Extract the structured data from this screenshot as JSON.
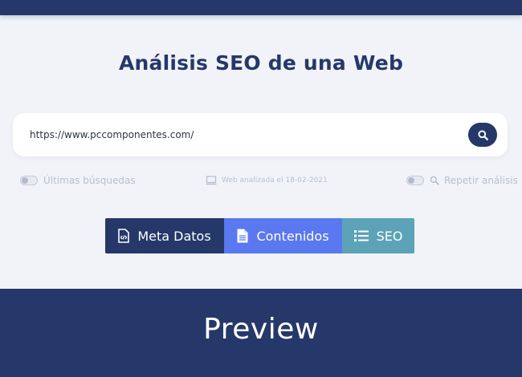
{
  "page": {
    "title": "Análisis SEO de una Web",
    "preview_heading": "Preview"
  },
  "search": {
    "value": "https://www.pccomponentes.com/",
    "button_icon": "search-icon"
  },
  "options": {
    "recent_searches_label": "Últimas búsquedas",
    "analyzed_label": "Web analizada el 18-02-2021",
    "repeat_label": "Repetir análisis"
  },
  "tabs": [
    {
      "label": "Meta Datos",
      "icon": "file-code-icon"
    },
    {
      "label": "Contenidos",
      "icon": "document-icon"
    },
    {
      "label": "SEO",
      "icon": "list-icon"
    }
  ],
  "colors": {
    "navy": "#253869",
    "tab_content": "#5a78f0",
    "tab_seo": "#5da3b8",
    "background": "#f1f3f8"
  }
}
